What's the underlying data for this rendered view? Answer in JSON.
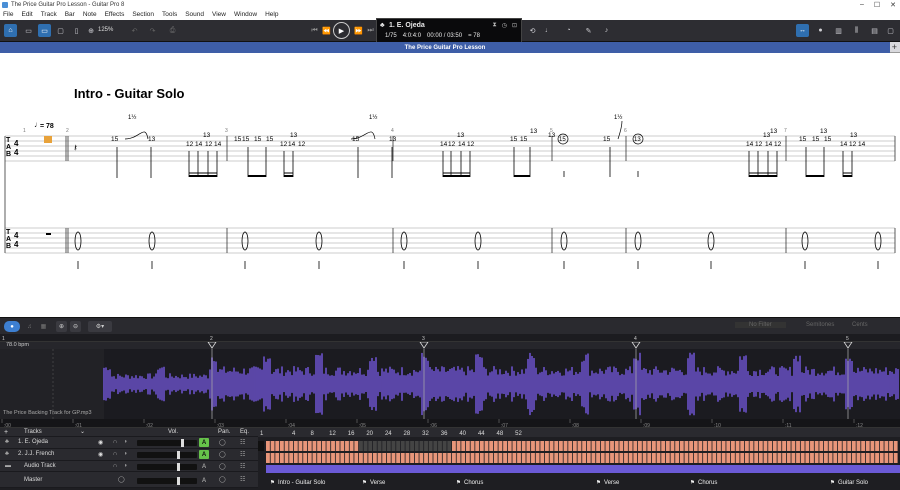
{
  "window": {
    "title": "The Price Guitar Pro Lesson - Guitar Pro 8"
  },
  "menu": [
    "File",
    "Edit",
    "Track",
    "Bar",
    "Note",
    "Effects",
    "Section",
    "Tools",
    "Sound",
    "View",
    "Window",
    "Help"
  ],
  "toolbar": {
    "zoom": "125%"
  },
  "lcd": {
    "track": "1. E. Ojeda",
    "bar": "1/75",
    "sig": "4:0:4:0",
    "time": "00:00 / 03:50",
    "tempo": "= 78"
  },
  "document": {
    "tab_title": "The Price Guitar Pro Lesson"
  },
  "score": {
    "section_title": "Intro - Guitar Solo",
    "tempo_label": "= 78",
    "staff1": {
      "bend_labels": [
        "1½",
        "1½",
        "1½"
      ],
      "frets_15": [
        "15",
        "15",
        "15",
        "15",
        "15",
        "15",
        "15",
        "15",
        "15",
        "15",
        "15",
        "15"
      ],
      "frets_13": [
        "13",
        "13",
        "13",
        "13",
        "13",
        "13",
        "13",
        "13",
        "13",
        "13",
        "13"
      ],
      "frets_1214": [
        "12",
        "14",
        "12",
        "14",
        "12",
        "14",
        "12",
        "14",
        "12",
        "14",
        "12",
        "14",
        "12",
        "14",
        "12",
        "14",
        "12",
        "14"
      ],
      "circled": [
        "15",
        "13"
      ],
      "bar_numbers": [
        "1",
        "2",
        "3",
        "4",
        "5",
        "6",
        "7"
      ]
    }
  },
  "mixer": {
    "bpm_label": "78.0 bpm",
    "wave_label": "The Price Backing Track for GP.mp3",
    "right_labels": [
      "No Filter",
      "Semitones",
      "Cents"
    ],
    "ruler_marks": [
      "1",
      "2",
      "3",
      "4",
      "5"
    ],
    "time_marks": [
      "00",
      "01",
      "02",
      "03",
      "04",
      "05",
      "06",
      "07",
      "08",
      "09",
      "10",
      "11",
      "12"
    ]
  },
  "tracks": {
    "header_label": "Tracks",
    "vol_label": "Vol.",
    "pan_label": "Pan.",
    "eq_label": "Eq.",
    "rows": [
      {
        "name": "1. E. Ojeda",
        "auto": "A"
      },
      {
        "name": "2. J.J. French",
        "auto": "A"
      },
      {
        "name": "Audio Track",
        "auto": "A"
      },
      {
        "name": "Master",
        "auto": "A"
      }
    ],
    "bar_numbers": [
      "1",
      "4",
      "8",
      "12",
      "16",
      "20",
      "24",
      "28",
      "32",
      "36",
      "40",
      "44",
      "48",
      "52"
    ],
    "sections": [
      "Intro - Guitar Solo",
      "Verse",
      "Chorus",
      "Verse",
      "Chorus",
      "Guitar Solo"
    ]
  },
  "colors": {
    "accent": "#3d7fd1",
    "track_bar": "#e8967a",
    "wave": "#6b52c9",
    "audio_bar": "#6b5ad6"
  }
}
